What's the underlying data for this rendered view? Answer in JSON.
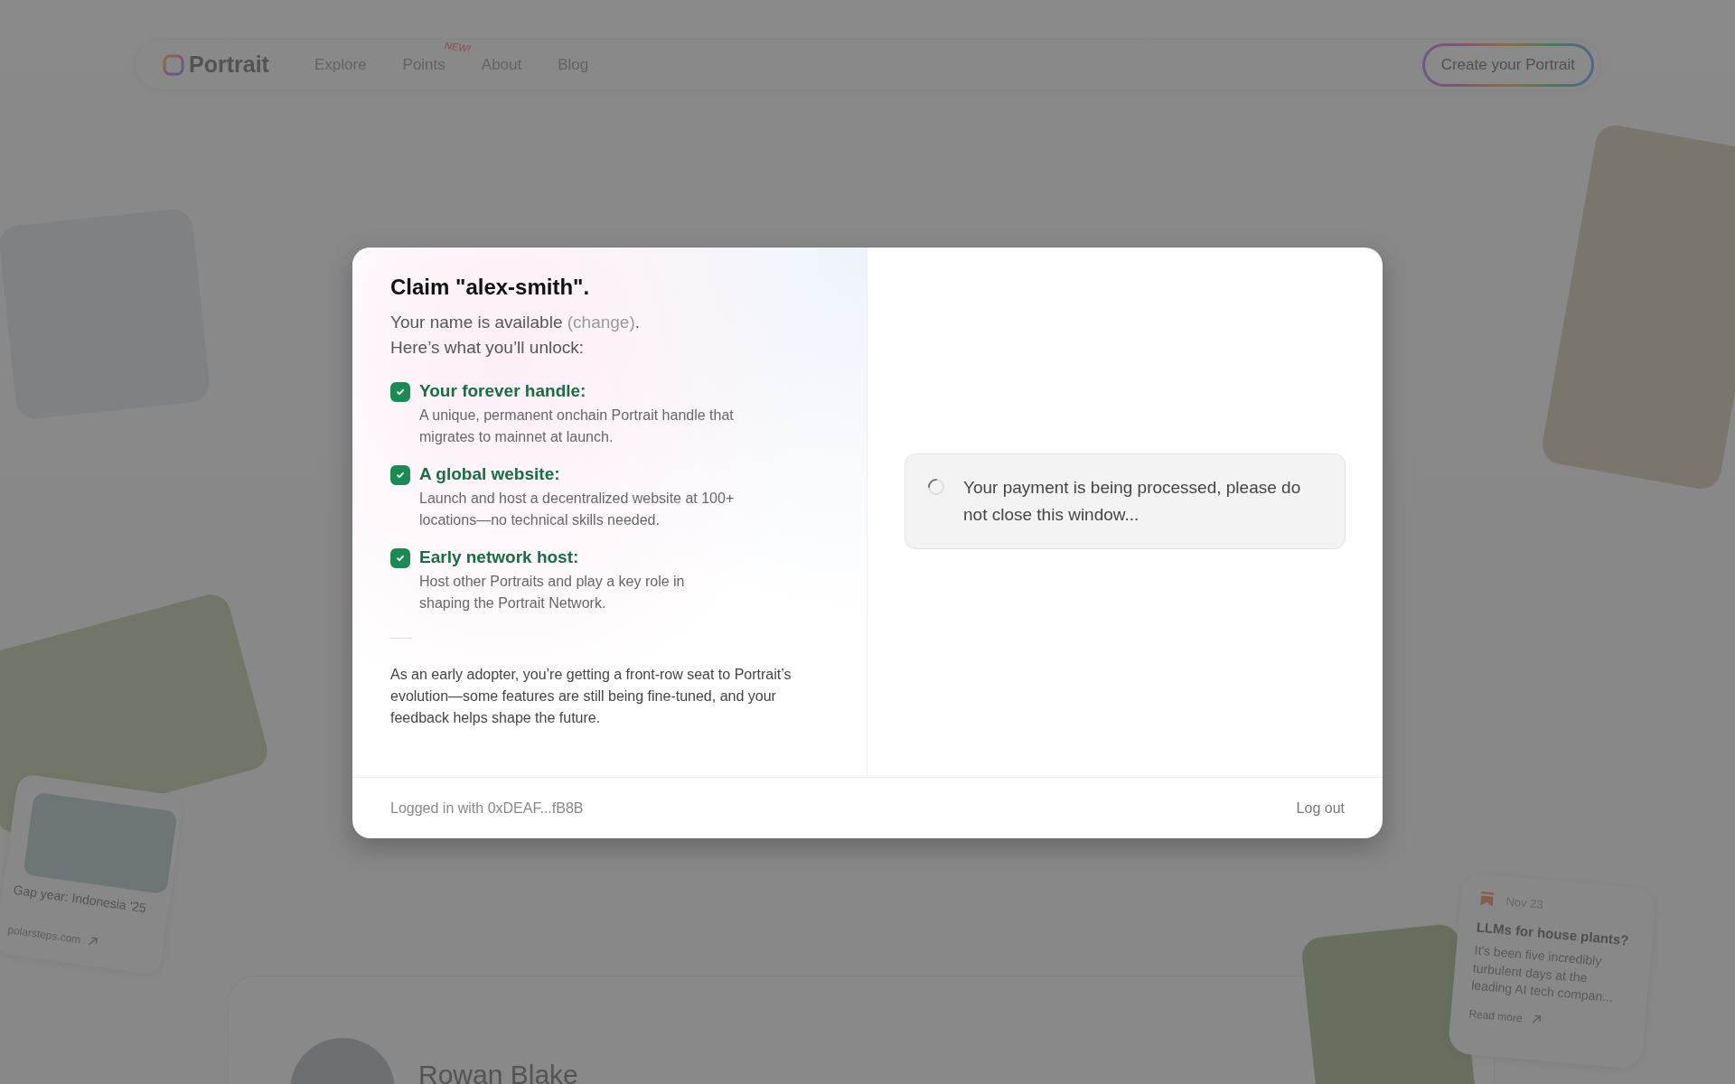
{
  "nav": {
    "logo": "Portrait",
    "links": [
      {
        "label": "Explore"
      },
      {
        "label": "Points",
        "badge": "NEW!"
      },
      {
        "label": "About"
      },
      {
        "label": "Blog"
      }
    ],
    "cta": "Create your Portrait"
  },
  "background": {
    "trip_card": {
      "title": "Gap year: Indonesia '25",
      "link": "polarsteps.com"
    },
    "blog_card": {
      "date": "Nov 23",
      "title": "LLMs for house plants?",
      "excerpt": "It's been five incredibly turbulent days at the leading AI tech compan...",
      "link": "Read more"
    },
    "profile": {
      "name": "Rowan Blake"
    }
  },
  "modal": {
    "title": "Claim \"alex-smith\".",
    "subtitle": "Your name is available ",
    "change_link": "(change)",
    "subtitle_end": ".",
    "unlock": "Here’s what you’ll unlock:",
    "features": [
      {
        "title": "Your forever handle:",
        "description": "A unique, permanent onchain Portrait handle that migrates to mainnet at launch.",
        "checked": true
      },
      {
        "title": "A global website:",
        "description": "Launch and host a decentralized website at 100+ locations—no technical skills needed.",
        "checked": true
      },
      {
        "title": "Early network host:",
        "description": "Host other Portraits and play a key role in shaping the Portrait Network.",
        "checked": true
      }
    ],
    "note": "As an early adopter, you’re getting a front-row seat to Portrait’s evolution—some features are still being fine-tuned, and your feedback helps shape the future.",
    "status": {
      "loading": true,
      "message": "Your payment is being processed, please do not close this window..."
    },
    "footer": {
      "account": "Logged in with 0xDEAF...fB8B",
      "logout": "Log out"
    }
  }
}
